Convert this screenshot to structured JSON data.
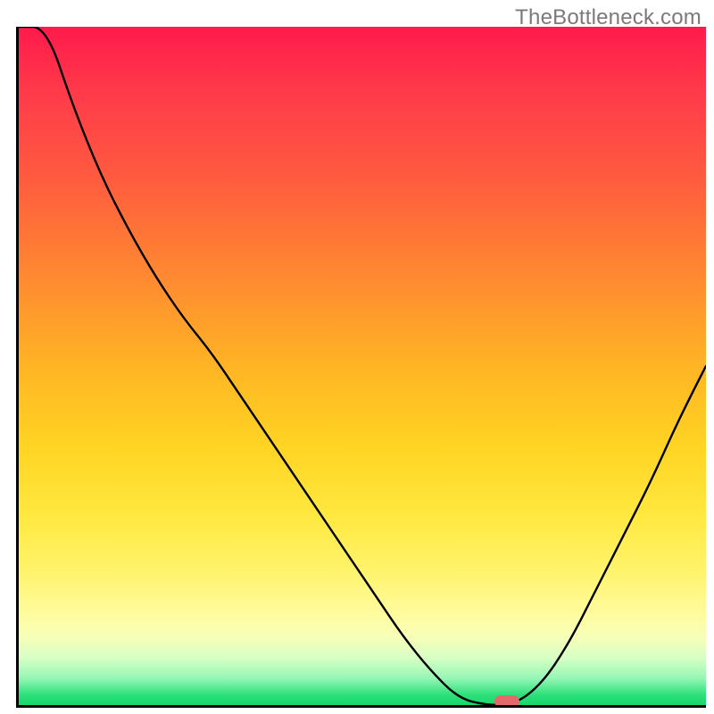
{
  "watermark": "TheBottleneck.com",
  "chart_data": {
    "type": "line",
    "title": "",
    "xlabel": "",
    "ylabel": "",
    "x": [
      0,
      4,
      8,
      12,
      16,
      20,
      24,
      28,
      32,
      36,
      40,
      44,
      48,
      52,
      56,
      60,
      64,
      68,
      72,
      76,
      80,
      84,
      88,
      92,
      96,
      100
    ],
    "values": [
      100,
      100,
      88,
      78,
      70,
      63,
      57,
      52,
      46,
      40,
      34,
      28,
      22,
      16,
      10,
      5,
      1,
      0,
      0,
      3,
      9,
      17,
      25,
      33,
      42,
      50
    ],
    "xlim": [
      0,
      100
    ],
    "ylim": [
      0,
      100
    ],
    "background_gradient": {
      "direction": "vertical",
      "stops": [
        {
          "pos": 0.0,
          "color": "#ff1a4b"
        },
        {
          "pos": 0.5,
          "color": "#ffba23"
        },
        {
          "pos": 0.8,
          "color": "#fff36a"
        },
        {
          "pos": 1.0,
          "color": "#16d86a"
        }
      ]
    },
    "marker": {
      "x": 71,
      "y": 0.5,
      "color": "#e06a6a",
      "shape": "pill"
    },
    "grid": false,
    "legend": false
  }
}
